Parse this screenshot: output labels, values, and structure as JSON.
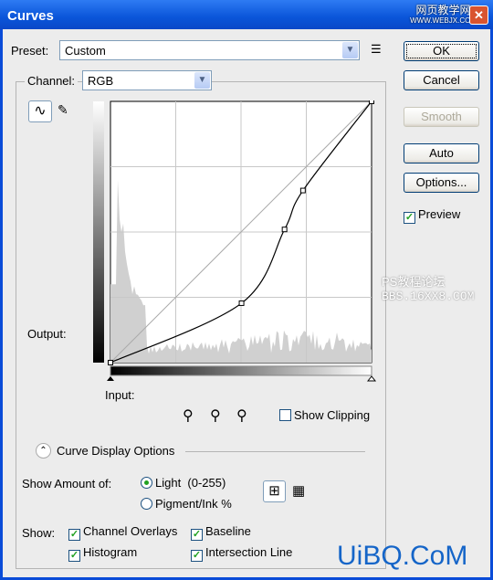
{
  "window": {
    "title": "Curves",
    "watermark_top": "网页教学网",
    "watermark_top_sub": "WWW.WEBJX.COM"
  },
  "preset": {
    "label": "Preset:",
    "value": "Custom"
  },
  "channel": {
    "label": "Channel:",
    "value": "RGB"
  },
  "buttons": {
    "ok": "OK",
    "cancel": "Cancel",
    "smooth": "Smooth",
    "auto": "Auto",
    "options": "Options..."
  },
  "preview": {
    "label": "Preview",
    "checked": true
  },
  "graph": {
    "output_label": "Output:",
    "input_label": "Input:",
    "curve_points": [
      [
        0,
        0
      ],
      [
        128,
        58
      ],
      [
        170,
        130
      ],
      [
        188,
        168
      ],
      [
        255,
        255
      ]
    ]
  },
  "show_clipping": {
    "label": "Show Clipping",
    "checked": false
  },
  "display_options": {
    "title": "Curve Display Options",
    "show_amount_label": "Show Amount of:",
    "light_label": "Light  (0-255)",
    "pigment_label": "Pigment/Ink %",
    "selected": "light",
    "show_label": "Show:",
    "checks": {
      "channel_overlays": "Channel Overlays",
      "baseline": "Baseline",
      "histogram": "Histogram",
      "intersection_line": "Intersection Line"
    }
  },
  "watermarks": {
    "mid1": "PS教程论坛",
    "mid2": "BBS.16XX8.COM",
    "bottom": "UiBQ.CoM"
  }
}
